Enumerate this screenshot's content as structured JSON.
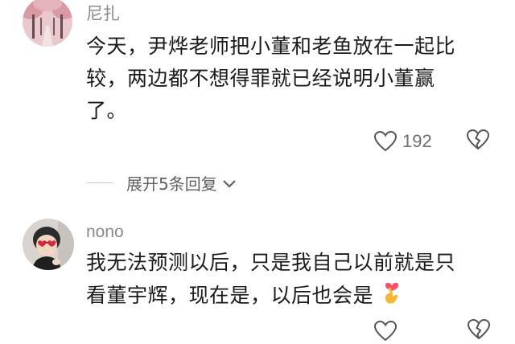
{
  "comments": [
    {
      "username": "尼扎",
      "text_lines": [
        "今天，尹烨老师把小董和老鱼放在一起比",
        "较，两边都不想得罪就已经说明小董赢",
        "了。"
      ],
      "likes": "192",
      "avatar_icon": "cherry-blossom-avenue-avatar"
    },
    {
      "username": "nono",
      "text_lines": [
        "我无法预测以后，只是我自己以前就是只",
        "看董宇辉，现在是，以后也会是"
      ],
      "avatar_icon": "girl-with-heart-sunglasses-avatar",
      "trailing_emoji": "finger-heart-emoji"
    }
  ],
  "replies": {
    "expand_label": "展开5条回复"
  },
  "colors": {
    "username": "#8a8a8a",
    "text": "#1a1a1a",
    "icon": "#555555",
    "accent_heart": "#ff4d6d"
  }
}
